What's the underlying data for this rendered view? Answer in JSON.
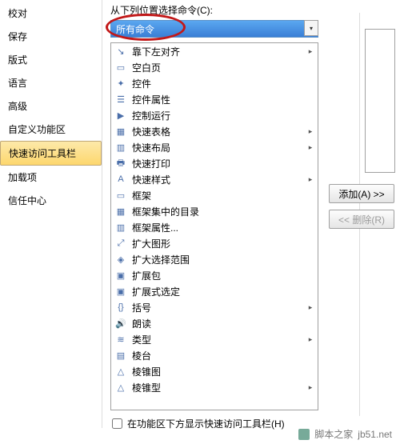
{
  "sidebar": {
    "items": [
      {
        "label": "校对"
      },
      {
        "label": "保存"
      },
      {
        "label": "版式"
      },
      {
        "label": "语言"
      },
      {
        "label": "高级"
      },
      {
        "label": "自定义功能区"
      },
      {
        "label": "快速访问工具栏"
      },
      {
        "label": "加载项"
      },
      {
        "label": "信任中心"
      }
    ],
    "active_index": 6
  },
  "main": {
    "prompt_label": "从下列位置选择命令(C):",
    "dropdown_value": "所有命令",
    "checkbox_label": "在功能区下方显示快速访问工具栏(H)",
    "checkbox_checked": false
  },
  "buttons": {
    "add_label": "添加(A) >>",
    "remove_label": "<< 删除(R)"
  },
  "commands": [
    {
      "icon": "↘",
      "label": "靠下左对齐",
      "expand": true
    },
    {
      "icon": "▭",
      "label": "空白页",
      "expand": false
    },
    {
      "icon": "✦",
      "label": "控件",
      "expand": false
    },
    {
      "icon": "☰",
      "label": "控件属性",
      "expand": false
    },
    {
      "icon": "▶",
      "label": "控制运行",
      "expand": false
    },
    {
      "icon": "▦",
      "label": "快速表格",
      "expand": true
    },
    {
      "icon": "▥",
      "label": "快速布局",
      "expand": true
    },
    {
      "icon": "🖶",
      "label": "快速打印",
      "expand": false
    },
    {
      "icon": "A",
      "label": "快速样式",
      "expand": true
    },
    {
      "icon": "▭",
      "label": "框架",
      "expand": false
    },
    {
      "icon": "▦",
      "label": "框架集中的目录",
      "expand": false
    },
    {
      "icon": "▥",
      "label": "框架属性...",
      "expand": false
    },
    {
      "icon": "⤢",
      "label": "扩大图形",
      "expand": false
    },
    {
      "icon": "◈",
      "label": "扩大选择范围",
      "expand": false
    },
    {
      "icon": "▣",
      "label": "扩展包",
      "expand": false
    },
    {
      "icon": "▣",
      "label": "扩展式选定",
      "expand": false
    },
    {
      "icon": "{}",
      "label": "括号",
      "expand": true
    },
    {
      "icon": "🔊",
      "label": "朗读",
      "expand": false
    },
    {
      "icon": "≋",
      "label": "类型",
      "expand": true
    },
    {
      "icon": "▤",
      "label": "棱台",
      "expand": false
    },
    {
      "icon": "△",
      "label": "棱锥图",
      "expand": false
    },
    {
      "icon": "△",
      "label": "棱锥型",
      "expand": true
    }
  ],
  "footer": {
    "site": "脚本之家",
    "url": "jb51.net"
  }
}
